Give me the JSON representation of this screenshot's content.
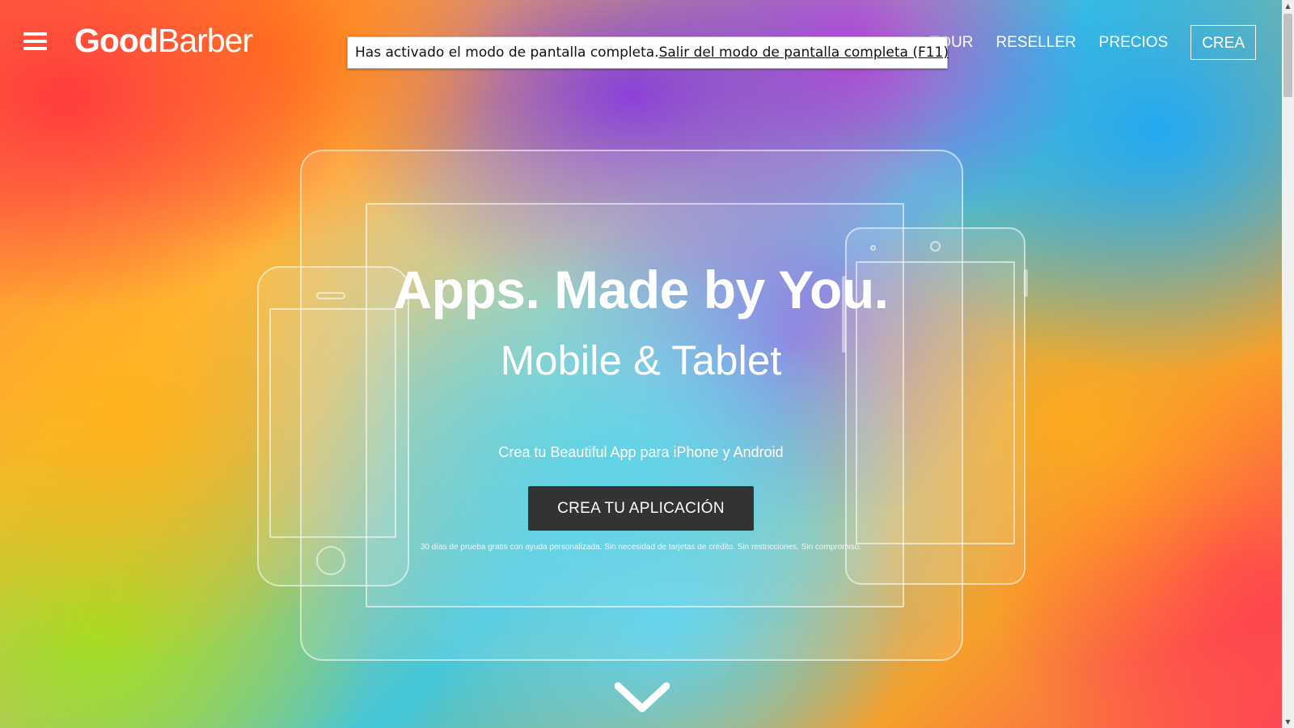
{
  "header": {
    "logo_good": "Good",
    "logo_barber": "Barber",
    "nav": [
      {
        "label": "TOUR"
      },
      {
        "label": "RESELLER"
      },
      {
        "label": "PRECIOS"
      }
    ],
    "cta_label": "CREA"
  },
  "fullscreen_notice": {
    "message": "Has activado el modo de pantalla completa.",
    "exit_link": "Salir del modo de pantalla completa (F11)"
  },
  "hero": {
    "title": "Apps. Made by You.",
    "subtitle": "Mobile & Tablet",
    "tagline": "Crea tu Beautiful App para iPhone y Android",
    "cta_button": "CREA TU APLICACIÓN",
    "fine_print": "30 días de prueba gratis con ayuda personalizada. Sin necesidad de tarjetas de crédito. Sin restricciones. Sin compromiso."
  },
  "icons": {
    "menu": "hamburger-menu-icon",
    "scroll_down": "chevron-down-icon",
    "scroll_up_arrow": "triangle-up-icon",
    "scroll_down_arrow": "triangle-down-icon"
  },
  "colors": {
    "cta_background": "#333333",
    "text": "#ffffff",
    "notice_background": "#ffffff"
  }
}
